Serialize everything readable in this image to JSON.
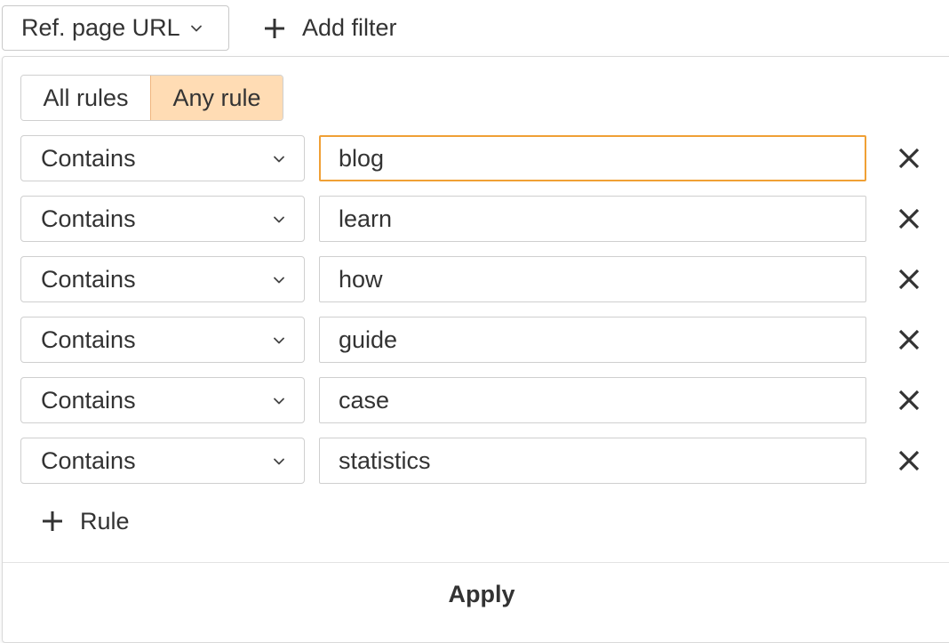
{
  "filter_bar": {
    "active_filter_label": "Ref. page URL",
    "add_filter_label": "Add filter"
  },
  "panel": {
    "match_modes": [
      {
        "label": "All rules",
        "selected": false
      },
      {
        "label": "Any rule",
        "selected": true
      }
    ],
    "rules": [
      {
        "operator": "Contains",
        "value": "blog",
        "focused": true
      },
      {
        "operator": "Contains",
        "value": "learn",
        "focused": false
      },
      {
        "operator": "Contains",
        "value": "how",
        "focused": false
      },
      {
        "operator": "Contains",
        "value": "guide",
        "focused": false
      },
      {
        "operator": "Contains",
        "value": "case",
        "focused": false
      },
      {
        "operator": "Contains",
        "value": "statistics",
        "focused": false
      }
    ],
    "add_rule_label": "Rule",
    "apply_label": "Apply"
  },
  "colors": {
    "selected_segment_bg": "#ffdcb4",
    "focus_border": "#f0a035",
    "text": "#333333"
  },
  "icons": {
    "chevron": "chevron-down-icon",
    "plus": "plus-icon",
    "remove": "close-icon"
  }
}
